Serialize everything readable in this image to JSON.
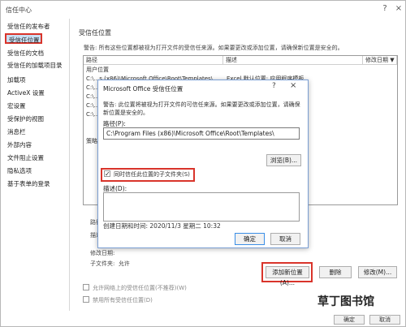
{
  "window": {
    "title": "信任中心"
  },
  "sidebar": {
    "items": [
      "受信任的发布者",
      "受信任位置",
      "受信任的文档",
      "受信任的加载项目录",
      "加载项",
      "ActiveX 设置",
      "宏设置",
      "受保护的视图",
      "消息栏",
      "外部内容",
      "文件阻止设置",
      "隐私选项",
      "基于表单的登录"
    ],
    "active_index": 1
  },
  "main": {
    "section_title": "受信任位置",
    "warning": "警告: 所有这些位置都被视为打开文件的受信任来源。如果要更改或添加位置，请确保新位置是安全的。",
    "columns": {
      "path": "路径",
      "desc": "描述",
      "modified": "修改日期 ▼"
    },
    "group_user": "用户位置",
    "rows": [
      {
        "path": "C:\\...s (x86)\\Microsoft Office\\Root\\Templates\\",
        "desc": "Excel 默认位置: 应用程序模板"
      },
      {
        "path": "C:\\..."
      },
      {
        "path": "C:\\..."
      },
      {
        "path": "C:\\..."
      },
      {
        "path": "C:\\..."
      }
    ],
    "group_policy": "策略",
    "path_lbl": "路径:",
    "desc_lbl": "描述:",
    "modified_lbl": "修改日期:",
    "subfolders_lbl": "子文件夹:",
    "subfolders_val": "允许",
    "buttons": {
      "add": "添加新位置(A)...",
      "delete": "删除",
      "modify": "修改(M)..."
    },
    "checkbox_network": "允许网络上的受信任位置(不推荐)(W)",
    "checkbox_disable": "禁用所有受信任位置(D)",
    "footer_buttons": {
      "ok": "确定",
      "cancel": "取消"
    }
  },
  "modal": {
    "title": "Microsoft Office 受信任位置",
    "help": "?",
    "close": "×",
    "warning": "警告: 此位置将被视为打开文件的可信任来源。如果要更改或添加位置，请确保新位置是安全的。",
    "path_label": "路径(P):",
    "path_value": "C:\\Program Files (x86)\\Microsoft Office\\Root\\Templates\\",
    "browse": "浏览(B)...",
    "subfolders_checkbox": "同时信任此位置的子文件夹(S)",
    "desc_label": "描述(D):",
    "date_text": "创建日期和时间:   2020/11/3 星期二 10:32",
    "ok": "确定",
    "cancel": "取消"
  },
  "watermark": {
    "text": "草丁图书馆"
  },
  "colors": {
    "highlight": "#c9dff4",
    "annotation": "#d9342b",
    "accent": "#3a8ee6"
  }
}
